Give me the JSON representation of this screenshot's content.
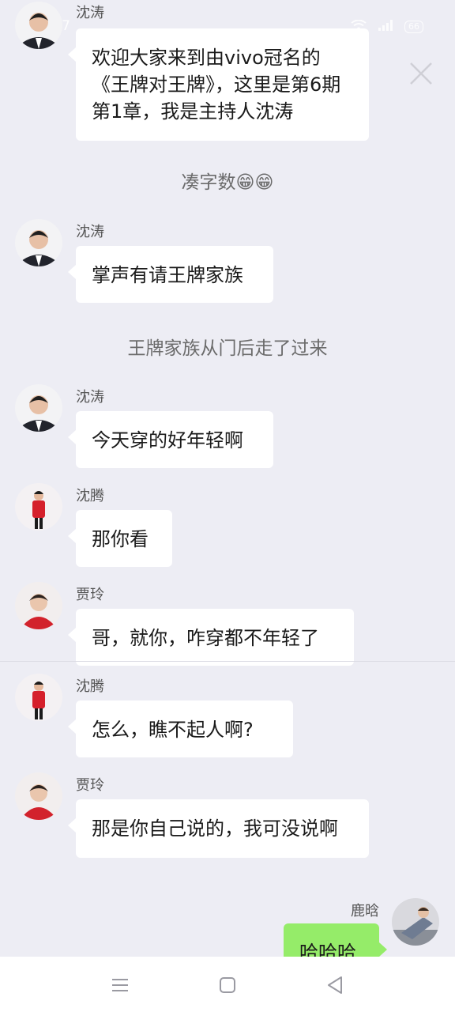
{
  "status_bar": {
    "time": "22:17",
    "battery": "66"
  },
  "messages": [
    {
      "sender": "沈涛",
      "text": "欢迎大家来到由vivo冠名的《王牌对王牌》，这里是第6期第1章，我是主持人沈涛"
    },
    {
      "sender": "沈涛",
      "text": "掌声有请王牌家族"
    },
    {
      "sender": "沈涛",
      "text": "今天穿的好年轻啊"
    },
    {
      "sender": "沈腾",
      "text": "那你看"
    },
    {
      "sender": "贾玲",
      "text": "哥，就你，咋穿都不年轻了"
    },
    {
      "sender": "沈腾",
      "text": "怎么，瞧不起人啊?"
    },
    {
      "sender": "贾玲",
      "text": "那是你自己说的，我可没说啊"
    },
    {
      "sender": "鹿晗",
      "text": "哈哈哈"
    }
  ],
  "system_messages": [
    "凑字数😁😁",
    "王牌家族从门后走了过来"
  ],
  "icons": {
    "close": "close-icon",
    "nav_menu": "menu-icon",
    "nav_home": "home-icon",
    "nav_back": "back-icon"
  },
  "colors": {
    "background": "#ededf4",
    "bubble": "#ffffff",
    "my_bubble": "#95ec69"
  }
}
